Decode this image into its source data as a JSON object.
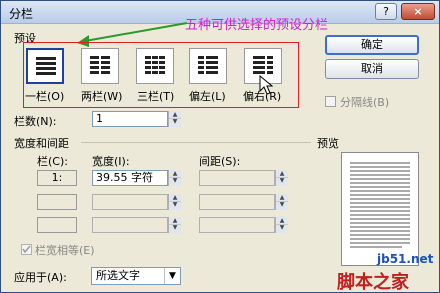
{
  "window": {
    "title": "分栏",
    "help_button": "?",
    "close_button": "×"
  },
  "annotation": "五种可供选择的预设分栏",
  "presets": {
    "section_label": "预设",
    "items": [
      {
        "label": "一栏(O)",
        "selected": true,
        "icon": "one-column-icon"
      },
      {
        "label": "两栏(W)",
        "selected": false,
        "icon": "two-columns-icon"
      },
      {
        "label": "三栏(T)",
        "selected": false,
        "icon": "three-columns-icon"
      },
      {
        "label": "偏左(L)",
        "selected": false,
        "icon": "left-columns-icon"
      },
      {
        "label": "偏右(R)",
        "selected": false,
        "icon": "right-columns-icon"
      }
    ]
  },
  "buttons": {
    "ok": "确定",
    "cancel": "取消"
  },
  "separator_checkbox": {
    "label": "分隔线(B)",
    "checked": false
  },
  "columns_count": {
    "label": "栏数(N):",
    "value": "1"
  },
  "width_spacing": {
    "section_label": "宽度和间距",
    "col_header": "栏(C):",
    "width_header": "宽度(I):",
    "spacing_header": "间距(S):",
    "rows": [
      {
        "col": "1:",
        "width": "39.55 字符",
        "spacing": ""
      },
      {
        "col": "",
        "width": "",
        "spacing": ""
      },
      {
        "col": "",
        "width": "",
        "spacing": ""
      }
    ]
  },
  "equal_width": {
    "label": "栏宽相等(E)",
    "checked": true
  },
  "apply_to": {
    "label": "应用于(A):",
    "value": "所选文字"
  },
  "preview": {
    "label": "预览"
  },
  "watermark": {
    "line1": "jb51.net",
    "line2": "脚本之家"
  }
}
